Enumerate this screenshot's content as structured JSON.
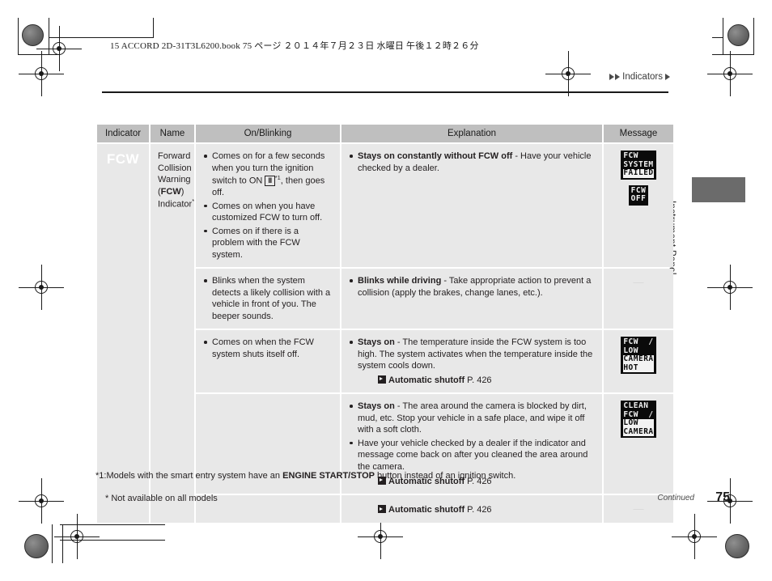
{
  "print_header": "15 ACCORD 2D-31T3L6200.book   75 ページ   ２０１４年７月２３日   水曜日   午後１２時２６分",
  "chapter_tag": "Indicators",
  "side_tab_label": "Instrument Panel",
  "table": {
    "headers": [
      "Indicator",
      "Name",
      "On/Blinking",
      "Explanation",
      "Message"
    ],
    "indicator_glyph": "FCW",
    "name": {
      "line1": "Forward",
      "line2": "Collision",
      "line3": "Warning",
      "line4_pre": "(",
      "line4_bold": "FCW",
      "line4_post": ")",
      "line5": "Indicator",
      "line5_footnote": "*"
    },
    "rows": [
      {
        "on_blinking": [
          {
            "pre": "Comes on for a few seconds when you turn the ignition switch to ON ",
            "icon": "II",
            "footnote": "*1",
            "post": ", then goes off."
          },
          {
            "pre": "Comes on when you have customized FCW to turn off."
          },
          {
            "pre": "Comes on if there is a problem with the FCW system."
          }
        ],
        "explanation": [
          {
            "bold": "Stays on constantly without FCW off",
            "text": " - Have your vehicle checked by a dealer."
          }
        ],
        "reference": null,
        "messages": [
          {
            "lines": [
              "FCW",
              "SYSTEM"
            ],
            "highlight": [
              "FAILED"
            ]
          },
          {
            "lines": [
              "FCW",
              "OFF"
            ],
            "highlight": []
          }
        ],
        "message_dash": null
      },
      {
        "on_blinking": [
          {
            "pre": "Blinks when the system detects a likely collision with a vehicle in front of you. The beeper sounds."
          }
        ],
        "explanation": [
          {
            "bold": "Blinks while driving",
            "text": " - Take appropriate action to prevent a collision (apply the brakes, change lanes, etc.)."
          }
        ],
        "reference": null,
        "messages": [],
        "message_dash": "—"
      },
      {
        "on_blinking": [
          {
            "pre": "Comes on when the FCW system shuts itself off."
          }
        ],
        "explanation": [
          {
            "bold": "Stays on",
            "text": " - The temperature inside the FCW system is too high. The system activates when the temperature inside the system cools down."
          }
        ],
        "reference": {
          "bold": "Automatic shutoff",
          "page": " P. 426"
        },
        "messages": [
          {
            "lines": [
              "FCW  /",
              "LOW"
            ],
            "highlight": [
              "CAMERA",
              "HOT"
            ]
          }
        ],
        "message_dash": null
      },
      {
        "on_blinking": [],
        "explanation": [
          {
            "bold": "Stays on",
            "text": " - The area around the camera is blocked by dirt, mud, etc. Stop your vehicle in a safe place, and wipe it off with a soft cloth."
          },
          {
            "bold": "",
            "text": "Have your vehicle checked by a dealer if the indicator and message come back on after you cleaned the area around the camera."
          }
        ],
        "reference": {
          "bold": "Automatic shutoff",
          "page": " P. 426"
        },
        "messages": [
          {
            "lines": [
              "CLEAN",
              "FCW  /"
            ],
            "highlight": [
              "LOW",
              "CAMERA"
            ]
          }
        ],
        "message_dash": null
      },
      {
        "on_blinking": [],
        "explanation": [],
        "reference": {
          "bold": "Automatic shutoff",
          "page": " P. 426"
        },
        "messages": [],
        "message_dash": "—"
      }
    ]
  },
  "footnotes": {
    "fn1_pre": "*1:Models with the smart entry system have an ",
    "fn1_bold": "ENGINE START/STOP",
    "fn1_post": " button instead of an ignition switch.",
    "fn2": "* Not available on all models"
  },
  "footer": {
    "continued": "Continued",
    "page_number": "75"
  }
}
